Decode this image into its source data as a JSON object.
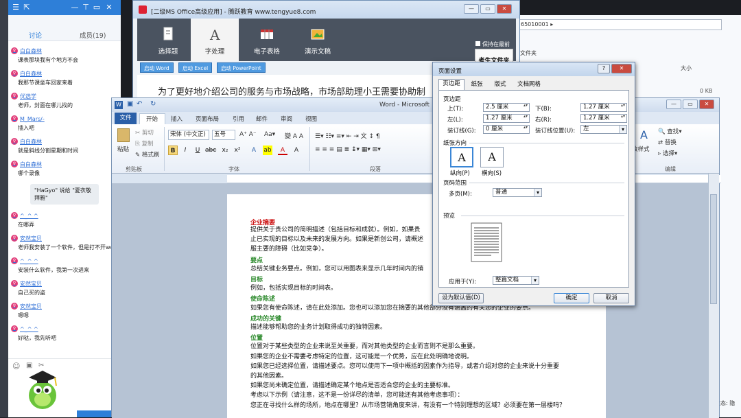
{
  "chat": {
    "tabs": {
      "discuss": "讨论",
      "members": "成员(19)"
    },
    "messages": [
      {
        "name": "白白森林",
        "text": "课表那块我有个地方不会"
      },
      {
        "name": "白白森林",
        "text": "我那节课坐车回家来着"
      },
      {
        "name": "优选学",
        "text": "老师，封面在哪儿找的"
      },
      {
        "name": "M_Mars/-",
        "text": "插入吧"
      },
      {
        "name": "白白森林",
        "text": "就是斜线分割星期和时间"
      },
      {
        "name": "白白森林",
        "text": "哪个录像"
      },
      {
        "bubble": "\"HaGyo\" 说给 \"夏衣敬拜雅\" "
      },
      {
        "name": "^_^ ^",
        "text": "在哪弄"
      },
      {
        "name": "安然宝贝",
        "text": "老师我安装了一个软件，但是打不开word,ppt等等"
      },
      {
        "name": "^_^ ^",
        "text": "安装什么软件，我第一次进来"
      },
      {
        "name": "安然宝贝",
        "text": "自己买的盗"
      },
      {
        "name": "安然宝贝",
        "text": "嗯嗯"
      },
      {
        "name": "^_^ ^",
        "text": "好哒，我先听吧"
      }
    ]
  },
  "exam": {
    "title": "[二级MS Office高级应用] - 腾跃教育 www.tengyue8.com",
    "nav": [
      "选择题",
      "字处理",
      "电子表格",
      "演示文稿"
    ],
    "keep_on_top": "保持在最前",
    "folder_button": "考生文件夹",
    "sub_buttons": [
      "启动 Word",
      "启动 Excel",
      "启动 PowerPoint"
    ],
    "question_line": "为了更好地介绍公司的服务与市场战略，市场部助理小王需要协助制"
  },
  "explorer": {
    "address": "65010001 ▸",
    "folder_label": "文件夹",
    "size_header": "大小",
    "size_value": "0 KB",
    "status": "状态: 隐"
  },
  "word": {
    "title": "Word - Microsoft",
    "tabs": [
      "文件",
      "开始",
      "插入",
      "页面布局",
      "引用",
      "邮件",
      "审阅",
      "视图"
    ],
    "ribbon": {
      "paste": "粘贴",
      "cut": "剪切",
      "copy": "复制",
      "format_painter": "格式刷",
      "clipboard": "剪贴板",
      "font_name": "宋体 (中文正)",
      "font_size": "五号",
      "font_group": "字体",
      "paragraph_group": "段落",
      "editing_group": "编辑",
      "find": "查找",
      "replace": "替换",
      "select": "选择",
      "styles": "改样式"
    },
    "document": {
      "heading": "企业摘要",
      "lines": [
        {
          "t": "提供关于贵公司的简明描述（包括目标和成就）。例如，如果贵",
          "h": false
        },
        {
          "t": "止已实现的目标以及未来的发展方向。如果是新创公司，请概述",
          "h": false
        },
        {
          "t": "服主要的障碍（比如竞争）。",
          "h": false
        },
        {
          "t": "要点",
          "h": true
        },
        {
          "t": "总结关键业务要点。例如，您可以用图表来显示几年时间内的销",
          "h": false
        },
        {
          "t": "目标",
          "h": true
        },
        {
          "t": "例如，包括实现目标的时间表。",
          "h": false
        },
        {
          "t": "使命陈述",
          "h": true
        },
        {
          "t": "如果您有使命陈述，请在此处添加。您也可以添加您在摘要的其他部分没有涵盖的有关您的企业的要点。",
          "h": false
        },
        {
          "t": "成功的关键",
          "h": true
        },
        {
          "t": "描述能够帮助您的业务计划取得成功的独特因素。",
          "h": false
        },
        {
          "t": "位置",
          "h": true
        },
        {
          "t": "位置对于某些类型的企业来说至关重要，而对其他类型的企业而言则不是那么重要。",
          "h": false
        },
        {
          "t": "如果您的企业不需要考虑特定的位置，这可能是一个优势，应在此处明确地说明。",
          "h": false
        },
        {
          "t": "如果您已经选择位置，请描述要点。您可以使用下一项中概括的因素作为指导，或者介绍对您的企业来说十分重要",
          "h": false
        },
        {
          "t": "的其他因素。",
          "h": false
        },
        {
          "t": "如果您尚未确定位置，请描述确定某个地点是否适合您的企业的主要标准。",
          "h": false
        },
        {
          "t": "考虑以下示例（请注意，这不是一份详尽的清单，您可能还有其他考虑事项）：",
          "h": false
        },
        {
          "t": "您正在寻找什么样的场所，地点在哪里？从市场营销角度来讲，有没有一个特别理想的区域？必须要在第一层楼吗？",
          "h": false
        }
      ]
    }
  },
  "dialog": {
    "title": "页面设置",
    "tabs": [
      "页边距",
      "纸张",
      "版式",
      "文档网格"
    ],
    "margins_group": "页边距",
    "top_label": "上(T):",
    "top_value": "2.5 厘米",
    "bottom_label": "下(B):",
    "bottom_value": "1.27 厘米",
    "left_label": "左(L):",
    "left_value": "1.27 厘米",
    "right_label": "右(R):",
    "right_value": "1.27 厘米",
    "gutter_label": "装订线(G):",
    "gutter_value": "0 厘米",
    "gutter_pos_label": "装订线位置(U):",
    "gutter_pos_value": "左",
    "orientation_group": "纸张方向",
    "portrait": "纵向(P)",
    "landscape": "横向(S)",
    "pages_group": "页码范围",
    "multi_pages_label": "多页(M):",
    "multi_pages_value": "普通",
    "preview_group": "预览",
    "apply_label": "应用于(Y):",
    "apply_value": "整篇文档",
    "default_button": "设为默认值(D)",
    "ok": "确定",
    "cancel": "取消"
  }
}
